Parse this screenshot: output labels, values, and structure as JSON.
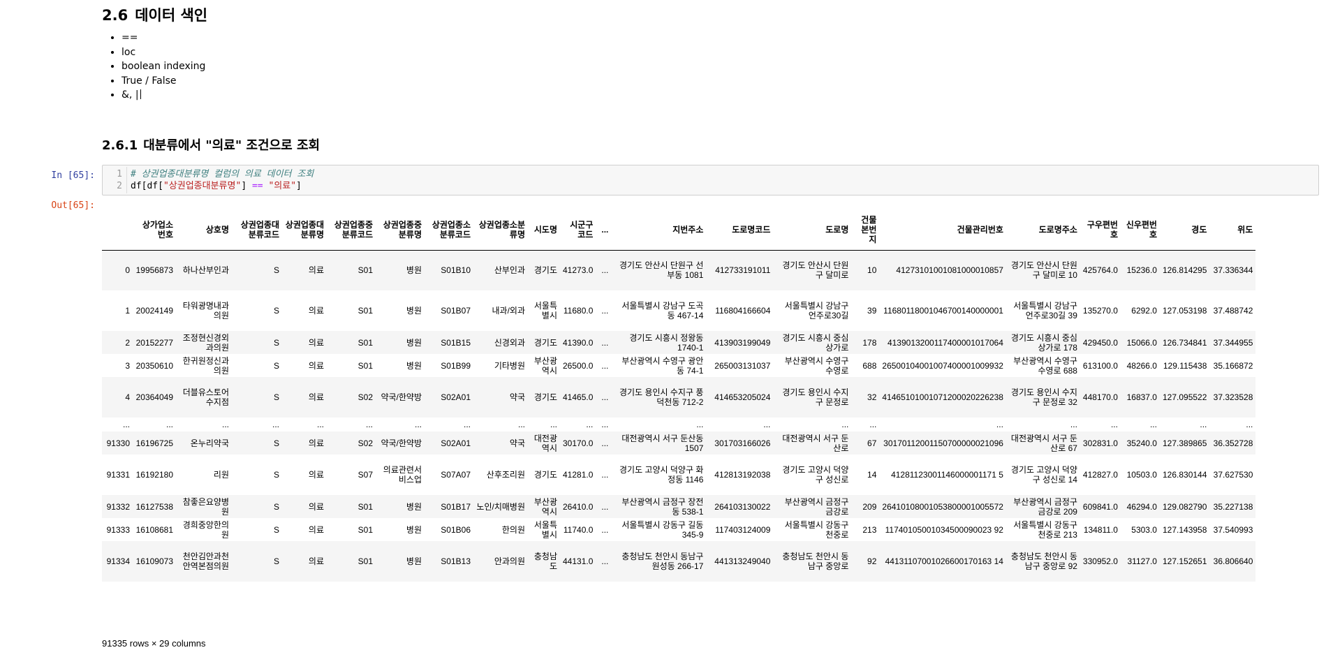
{
  "section": {
    "number": "2.6",
    "title": "데이터 색인"
  },
  "bullets": [
    "==",
    "loc",
    "boolean indexing",
    "True / False",
    "&, |"
  ],
  "subsection": {
    "number": "2.6.1",
    "title": "대분류에서 \"의료\" 조건으로 조회"
  },
  "cell": {
    "in_prompt": "In [65]:",
    "out_prompt": "Out[65]:",
    "line_numbers": [
      "1",
      "2"
    ],
    "code_comment": "# 상권업종대분류명 컬럼의 의료 데이터 조회",
    "code_pre": "df[df[",
    "code_str": "\"상권업종대분류명\"",
    "code_mid": "] ",
    "code_op": "==",
    "code_space": " ",
    "code_str2": "\"의료\"",
    "code_post": "]"
  },
  "table": {
    "columns": [
      "",
      "상가업소번호",
      "상호명",
      "상권업종대분류코드",
      "상권업종대분류명",
      "상권업종중분류코드",
      "상권업종중분류명",
      "상권업종소분류코드",
      "상권업종소분류명",
      "시도명",
      "시군구코드",
      "...",
      "지번주소",
      "도로명코드",
      "도로명",
      "건물본번지",
      "건물관리번호",
      "도로명주소",
      "구우편번호",
      "신우편번호",
      "경도",
      "위도"
    ],
    "rows": [
      [
        "0",
        "19956873",
        "하나산부인과",
        "S",
        "의료",
        "S01",
        "병원",
        "S01B10",
        "산부인과",
        "경기도",
        "41273.0",
        "...",
        "경기도 안산시 단원구 선부동 1081",
        "412733191011",
        "경기도 안산시 단원구 달미로",
        "10",
        "41273101001081000010857",
        "경기도 안산시 단원구 달미로 10",
        "425764.0",
        "15236.0",
        "126.814295",
        "37.336344"
      ],
      [
        "1",
        "20024149",
        "타워광명내과의원",
        "S",
        "의료",
        "S01",
        "병원",
        "S01B07",
        "내과/외과",
        "서울특별시",
        "11680.0",
        "...",
        "서울특별시 강남구 도곡동 467-14",
        "116804166604",
        "서울특별시 강남구 언주로30길",
        "39",
        "11680118001046700140000001",
        "서울특별시 강남구 언주로30길 39",
        "135270.0",
        "6292.0",
        "127.053198",
        "37.488742"
      ],
      [
        "2",
        "20152277",
        "조정현신경외과의원",
        "S",
        "의료",
        "S01",
        "병원",
        "S01B15",
        "신경외과",
        "경기도",
        "41390.0",
        "...",
        "경기도 시흥시 정왕동 1740-1",
        "413903199049",
        "경기도 시흥시 중심상가로",
        "178",
        "4139013200117400001017064",
        "경기도 시흥시 중심상가로 178",
        "429450.0",
        "15066.0",
        "126.734841",
        "37.344955"
      ],
      [
        "3",
        "20350610",
        "한귀원정신과의원",
        "S",
        "의료",
        "S01",
        "병원",
        "S01B99",
        "기타병원",
        "부산광역시",
        "26500.0",
        "...",
        "부산광역시 수영구 광안동 74-1",
        "265003131037",
        "부산광역시 수영구 수영로",
        "688",
        "26500104001007400001009932",
        "부산광역시 수영구 수영로 688",
        "613100.0",
        "48266.0",
        "129.115438",
        "35.166872"
      ],
      [
        "4",
        "20364049",
        "더블유스토어수지점",
        "S",
        "의료",
        "S02",
        "약국/한약방",
        "S02A01",
        "약국",
        "경기도",
        "41465.0",
        "...",
        "경기도 용인시 수지구 풍덕천동 712-2",
        "414653205024",
        "경기도 용인시 수지구 문정로",
        "32",
        "41465101001071200020226238",
        "경기도 용인시 수지구 문정로 32",
        "448170.0",
        "16837.0",
        "127.095522",
        "37.323528"
      ],
      [
        "...",
        "...",
        "...",
        "...",
        "...",
        "...",
        "...",
        "...",
        "...",
        "...",
        "...",
        "...",
        "...",
        "...",
        "...",
        "...",
        "...",
        "...",
        "...",
        "...",
        "...",
        "..."
      ],
      [
        "91330",
        "16196725",
        "온누리약국",
        "S",
        "의료",
        "S02",
        "약국/한약방",
        "S02A01",
        "약국",
        "대전광역시",
        "30170.0",
        "...",
        "대전광역시 서구 둔산동 1507",
        "301703166026",
        "대전광역시 서구 둔산로",
        "67",
        "30170112001150700000021096",
        "대전광역시 서구 둔산로 67",
        "302831.0",
        "35240.0",
        "127.389865",
        "36.352728"
      ],
      [
        "91331",
        "16192180",
        "리원",
        "S",
        "의료",
        "S07",
        "의료관련서비스업",
        "S07A07",
        "산후조리원",
        "경기도",
        "41281.0",
        "...",
        "경기도 고양시 덕양구 화정동 1146",
        "412813192038",
        "경기도 고양시 덕양구 성신로",
        "14",
        "41281123001146000001171 5",
        "경기도 고양시 덕양구 성신로 14",
        "412827.0",
        "10503.0",
        "126.830144",
        "37.627530"
      ],
      [
        "91332",
        "16127538",
        "참좋은요양병원",
        "S",
        "의료",
        "S01",
        "병원",
        "S01B17",
        "노인/치매병원",
        "부산광역시",
        "26410.0",
        "...",
        "부산광역시 금정구 장전동 538-1",
        "264103130022",
        "부산광역시 금정구 금강로",
        "209",
        "26410108001053800001005572",
        "부산광역시 금정구 금강로 209",
        "609841.0",
        "46294.0",
        "129.082790",
        "35.227138"
      ],
      [
        "91333",
        "16108681",
        "경희중앙한의원",
        "S",
        "의료",
        "S01",
        "병원",
        "S01B06",
        "한의원",
        "서울특별시",
        "11740.0",
        "...",
        "서울특별시 강동구 길동 345-9",
        "117403124009",
        "서울특별시 강동구 천중로",
        "213",
        "11740105001034500090023 92",
        "서울특별시 강동구 천중로 213",
        "134811.0",
        "5303.0",
        "127.143958",
        "37.540993"
      ],
      [
        "91334",
        "16109073",
        "천안김안과천안역본점의원",
        "S",
        "의료",
        "S01",
        "병원",
        "S01B13",
        "안과의원",
        "충청남도",
        "44131.0",
        "...",
        "충청남도 천안시 동남구 원성동 266-17",
        "441313249040",
        "충청남도 천안시 동남구 중앙로",
        "92",
        "44131107001026600170163 14",
        "충청남도 천안시 동남구 중앙로 92",
        "330952.0",
        "31127.0",
        "127.152651",
        "36.806640"
      ]
    ],
    "shape": "91335 rows × 29 columns"
  }
}
